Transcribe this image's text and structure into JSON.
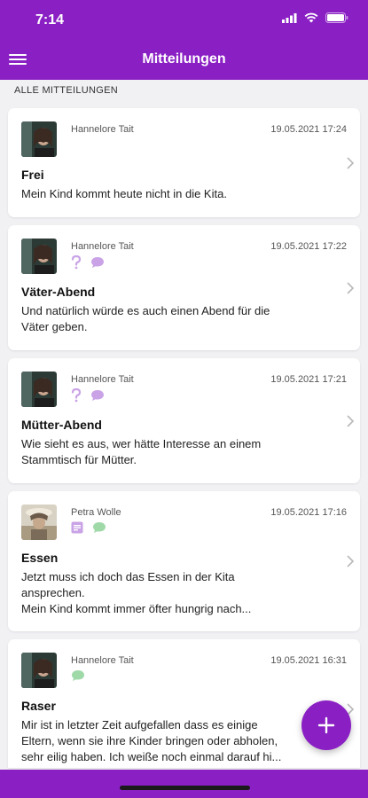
{
  "status_bar": {
    "time": "7:14"
  },
  "header": {
    "title": "Mitteilungen"
  },
  "section": {
    "label": "ALLE MITTEILUNGEN"
  },
  "messages": [
    {
      "author": "Hannelore Tait",
      "date": "19.05.2021 17:24",
      "title": "Frei",
      "body": "Mein Kind kommt heute nicht in die Kita.",
      "icons": []
    },
    {
      "author": "Hannelore Tait",
      "date": "19.05.2021 17:22",
      "title": "Väter-Abend",
      "body": "Und natürlich würde es auch einen Abend für die\nVäter geben.",
      "icons": [
        "question-icon",
        "chat-icon"
      ]
    },
    {
      "author": "Hannelore Tait",
      "date": "19.05.2021 17:21",
      "title": "Mütter-Abend",
      "body": "Wie sieht es aus, wer hätte Interesse an einem\nStammtisch für Mütter.",
      "icons": [
        "question-icon",
        "chat-icon"
      ]
    },
    {
      "author": "Petra Wolle",
      "date": "19.05.2021 17:16",
      "title": "Essen",
      "body": "Jetzt muss ich doch das Essen in der Kita\nansprechen.\nMein Kind kommt immer öfter hungrig nach...",
      "icons": [
        "document-icon",
        "chat-icon"
      ]
    },
    {
      "author": "Hannelore Tait",
      "date": "19.05.2021 16:31",
      "title": "Raser",
      "body": "Mir ist in letzter Zeit aufgefallen dass es einige\nEltern, wenn sie ihre Kinder bringen oder abholen,\nsehr eilig haben. Ich weiße noch einmal darauf hi...",
      "icons": [
        "chat-icon"
      ]
    }
  ],
  "colors": {
    "primary": "#8a1fc4",
    "icon_purple": "#c9a3e6",
    "icon_green": "#9fd9a8"
  }
}
